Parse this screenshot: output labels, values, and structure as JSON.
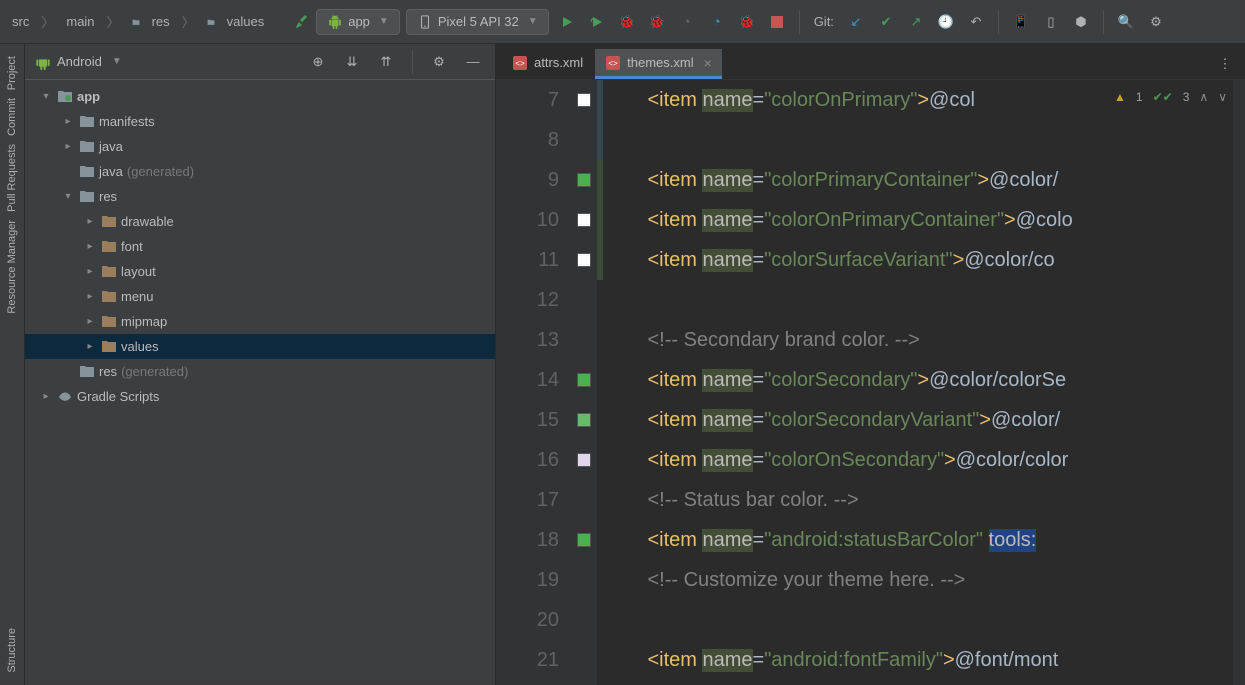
{
  "breadcrumb": [
    "src",
    "main",
    "res",
    "values"
  ],
  "runConfig": "app",
  "deviceConfig": "Pixel 5 API 32",
  "gitLabel": "Git:",
  "projectView": {
    "title": "Android"
  },
  "tree": [
    {
      "d": 0,
      "exp": "down",
      "icon": "module",
      "label": "app",
      "bold": true
    },
    {
      "d": 1,
      "exp": "right",
      "icon": "folder",
      "label": "manifests"
    },
    {
      "d": 1,
      "exp": "right",
      "icon": "pkg",
      "label": "java"
    },
    {
      "d": 1,
      "exp": "",
      "icon": "pkg-gen",
      "label": "java",
      "suffix": "(generated)"
    },
    {
      "d": 1,
      "exp": "down",
      "icon": "folder",
      "label": "res"
    },
    {
      "d": 2,
      "exp": "right",
      "icon": "res",
      "label": "drawable"
    },
    {
      "d": 2,
      "exp": "right",
      "icon": "res",
      "label": "font"
    },
    {
      "d": 2,
      "exp": "right",
      "icon": "res",
      "label": "layout"
    },
    {
      "d": 2,
      "exp": "right",
      "icon": "res",
      "label": "menu"
    },
    {
      "d": 2,
      "exp": "right",
      "icon": "res",
      "label": "mipmap"
    },
    {
      "d": 2,
      "exp": "right",
      "icon": "res",
      "label": "values",
      "selected": true
    },
    {
      "d": 1,
      "exp": "",
      "icon": "folder",
      "label": "res",
      "suffix": "(generated)"
    },
    {
      "d": 0,
      "exp": "right",
      "icon": "gradle",
      "label": "Gradle Scripts"
    }
  ],
  "tabs": [
    {
      "name": "attrs.xml",
      "active": false
    },
    {
      "name": "themes.xml",
      "active": true
    }
  ],
  "status": {
    "warnings": "1",
    "checks": "3"
  },
  "leftTabs": [
    "Project",
    "Commit",
    "Pull Requests",
    "Resource Manager"
  ],
  "leftBottom": "Structure",
  "codeLines": [
    {
      "n": 7,
      "swatch": "#ffffff",
      "vcs": "mod",
      "segs": [
        {
          "indent": 8
        },
        {
          "t": "<item",
          "c": "tag"
        },
        {
          "t": " "
        },
        {
          "t": "name",
          "c": "attr hl-occ"
        },
        {
          "t": "=",
          "c": "eq"
        },
        {
          "t": "\"colorOnPrimary\"",
          "c": "str"
        },
        {
          "t": ">",
          "c": "tag"
        },
        {
          "t": "@col",
          "c": "txt"
        }
      ]
    },
    {
      "n": 8,
      "vcs": "mod"
    },
    {
      "n": 9,
      "swatch": "#4caf50",
      "vcs": "add",
      "segs": [
        {
          "indent": 8
        },
        {
          "t": "<item",
          "c": "tag"
        },
        {
          "t": " "
        },
        {
          "t": "name",
          "c": "attr hl-occ"
        },
        {
          "t": "=",
          "c": "eq"
        },
        {
          "t": "\"colorPrimaryContainer\"",
          "c": "str"
        },
        {
          "t": ">",
          "c": "tag"
        },
        {
          "t": "@color/",
          "c": "txt"
        }
      ]
    },
    {
      "n": 10,
      "swatch": "#ffffff",
      "vcs": "add",
      "segs": [
        {
          "indent": 8
        },
        {
          "t": "<item",
          "c": "tag"
        },
        {
          "t": " "
        },
        {
          "t": "name",
          "c": "attr hl-occ"
        },
        {
          "t": "=",
          "c": "eq"
        },
        {
          "t": "\"colorOnPrimaryContainer\"",
          "c": "str"
        },
        {
          "t": ">",
          "c": "tag"
        },
        {
          "t": "@colo",
          "c": "txt"
        }
      ]
    },
    {
      "n": 11,
      "swatch": "#ffffff",
      "vcs": "add",
      "segs": [
        {
          "indent": 8
        },
        {
          "t": "<item",
          "c": "tag"
        },
        {
          "t": " "
        },
        {
          "t": "name",
          "c": "attr hl-occ"
        },
        {
          "t": "=",
          "c": "eq"
        },
        {
          "t": "\"colorSurfaceVariant\"",
          "c": "str"
        },
        {
          "t": ">",
          "c": "tag"
        },
        {
          "t": "@color/co",
          "c": "txt"
        }
      ]
    },
    {
      "n": 12
    },
    {
      "n": 13,
      "segs": [
        {
          "indent": 8
        },
        {
          "t": "<!-- Secondary brand color. -->",
          "c": "com"
        }
      ]
    },
    {
      "n": 14,
      "swatch": "#4caf50",
      "segs": [
        {
          "indent": 8
        },
        {
          "t": "<item",
          "c": "tag"
        },
        {
          "t": " "
        },
        {
          "t": "name",
          "c": "attr hl-occ"
        },
        {
          "t": "=",
          "c": "eq"
        },
        {
          "t": "\"colorSecondary\"",
          "c": "str"
        },
        {
          "t": ">",
          "c": "tag"
        },
        {
          "t": "@color/colorSe",
          "c": "txt"
        }
      ]
    },
    {
      "n": 15,
      "swatch": "#66bb6a",
      "segs": [
        {
          "indent": 8
        },
        {
          "t": "<item",
          "c": "tag"
        },
        {
          "t": " "
        },
        {
          "t": "name",
          "c": "attr hl-occ"
        },
        {
          "t": "=",
          "c": "eq"
        },
        {
          "t": "\"colorSecondaryVariant\"",
          "c": "str"
        },
        {
          "t": ">",
          "c": "tag"
        },
        {
          "t": "@color/",
          "c": "txt"
        }
      ]
    },
    {
      "n": 16,
      "swatch": "#e1d5ec",
      "segs": [
        {
          "indent": 8
        },
        {
          "t": "<item",
          "c": "tag"
        },
        {
          "t": " "
        },
        {
          "t": "name",
          "c": "attr hl-occ"
        },
        {
          "t": "=",
          "c": "eq"
        },
        {
          "t": "\"colorOnSecondary\"",
          "c": "str"
        },
        {
          "t": ">",
          "c": "tag"
        },
        {
          "t": "@color/color",
          "c": "txt"
        }
      ]
    },
    {
      "n": 17,
      "segs": [
        {
          "indent": 8
        },
        {
          "t": "<!-- Status bar color. -->",
          "c": "com"
        }
      ]
    },
    {
      "n": 18,
      "swatch": "#4caf50",
      "segs": [
        {
          "indent": 8
        },
        {
          "t": "<item",
          "c": "tag"
        },
        {
          "t": " "
        },
        {
          "t": "name",
          "c": "attr hl-occ"
        },
        {
          "t": "=",
          "c": "eq"
        },
        {
          "t": "\"android:statusBarColor\"",
          "c": "str"
        },
        {
          "t": " "
        },
        {
          "t": "tools:",
          "c": "attr hl"
        }
      ]
    },
    {
      "n": 19,
      "segs": [
        {
          "indent": 8
        },
        {
          "t": "<!-- Customize your theme here. -->",
          "c": "com"
        }
      ]
    },
    {
      "n": 20
    },
    {
      "n": 21,
      "segs": [
        {
          "indent": 8
        },
        {
          "t": "<item",
          "c": "tag"
        },
        {
          "t": " "
        },
        {
          "t": "name",
          "c": "attr hl-occ"
        },
        {
          "t": "=",
          "c": "eq"
        },
        {
          "t": "\"android:fontFamily\"",
          "c": "str"
        },
        {
          "t": ">",
          "c": "tag"
        },
        {
          "t": "@font/mont",
          "c": "txt"
        }
      ]
    }
  ]
}
